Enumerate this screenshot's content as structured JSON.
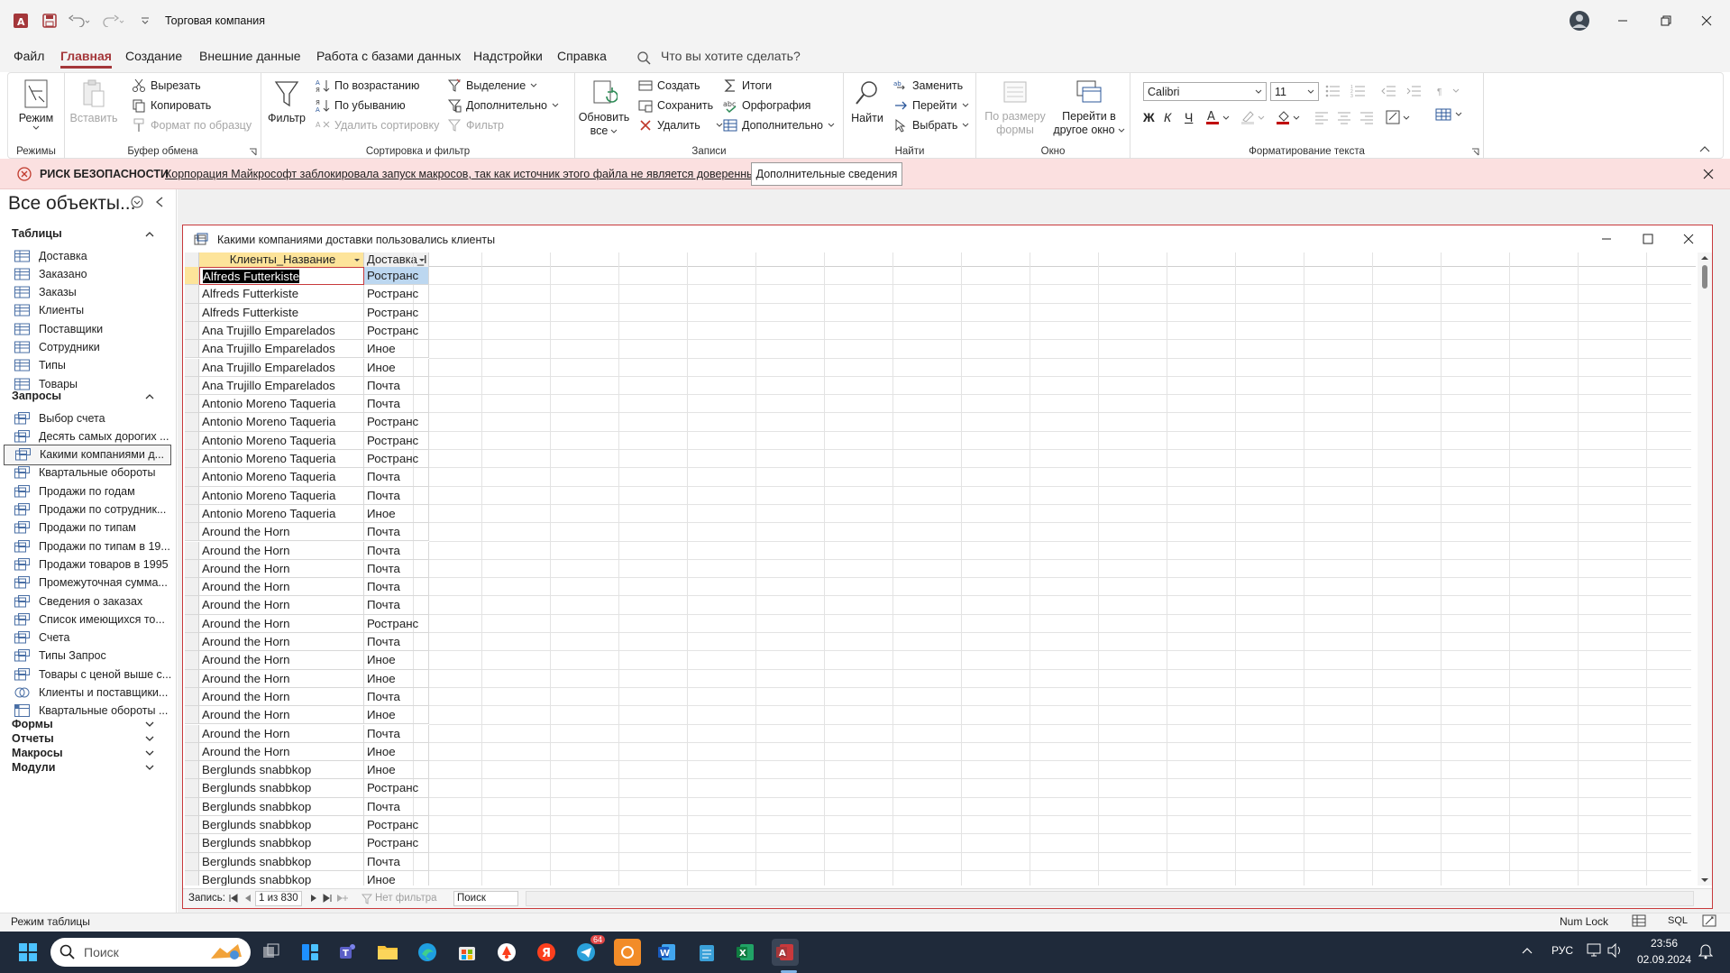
{
  "app": {
    "window_title": "Торговая компания",
    "brand_color": "#a4373a",
    "qat_icons": [
      "access-logo-icon",
      "save-icon",
      "undo-icon",
      "redo-icon",
      "customize-qat-icon"
    ],
    "window_controls": [
      "minimize-icon",
      "restore-icon",
      "close-icon"
    ]
  },
  "menu": {
    "tabs": [
      "Файл",
      "Главная",
      "Создание",
      "Внешние данные",
      "Работа с базами данных",
      "Надстройки",
      "Справка"
    ],
    "active_tab": "Главная",
    "search_placeholder": "Что вы хотите сделать?"
  },
  "ribbon": {
    "groups": {
      "views": {
        "title": "Режимы",
        "mode": "Режим"
      },
      "clipboard": {
        "title": "Буфер обмена",
        "paste": "Вставить",
        "cut": "Вырезать",
        "copy": "Копировать",
        "format_painter": "Формат по образцу"
      },
      "sort_filter": {
        "title": "Сортировка и фильтр",
        "filter": "Фильтр",
        "ascending": "По возрастанию",
        "descending": "По убыванию",
        "remove_sort": "Удалить сортировку",
        "selection": "Выделение",
        "advanced": "Дополнительно",
        "toggle_filter": "Фильтр"
      },
      "records": {
        "title": "Записи",
        "refresh_1": "Обновить",
        "refresh_2": "все",
        "new": "Создать",
        "save": "Сохранить",
        "delete": "Удалить",
        "totals": "Итоги",
        "spelling": "Орфография",
        "more": "Дополнительно"
      },
      "find": {
        "title": "Найти",
        "find": "Найти",
        "replace": "Заменить",
        "goto": "Перейти",
        "select": "Выбрать"
      },
      "window": {
        "title": "Окно",
        "fit_1": "По размеру",
        "fit_2": "формы",
        "switch_1": "Перейти в",
        "switch_2": "другое окно"
      },
      "text_format": {
        "title": "Форматирование текста",
        "font": "Calibri",
        "size": "11",
        "bold": "Ж",
        "italic": "К",
        "underline": "Ч"
      }
    }
  },
  "security_bar": {
    "label": "РИСК БЕЗОПАСНОСТИ",
    "message": "Корпорация Майкрософт заблокировала запуск макросов, так как источник этого файла не является доверенным.",
    "button": "Дополнительные сведения"
  },
  "nav_pane": {
    "header": "Все объекты...",
    "sections": [
      {
        "label": "Таблицы",
        "expanded": true,
        "items": [
          "Доставка",
          "Заказано",
          "Заказы",
          "Клиенты",
          "Поставщики",
          "Сотрудники",
          "Типы",
          "Товары"
        ]
      },
      {
        "label": "Запросы",
        "expanded": true,
        "items": [
          "Выбор счета",
          "Десять самых дорогих ...",
          "Какими компаниями д...",
          "Квартальные обороты",
          "Продажи по годам",
          "Продажи по сотрудник...",
          "Продажи по типам",
          "Продажи по типам в 19...",
          "Продажи товаров в 1995",
          "Промежуточная сумма...",
          "Сведения о заказах",
          "Список имеющихся то...",
          "Счета",
          "Типы Запрос",
          "Товары с ценой выше с...",
          "Клиенты и поставщики...",
          "Квартальные обороты ..."
        ]
      },
      {
        "label": "Формы",
        "expanded": false
      },
      {
        "label": "Отчеты",
        "expanded": false
      },
      {
        "label": "Макросы",
        "expanded": false
      },
      {
        "label": "Модули",
        "expanded": false
      }
    ],
    "selected_item": "Какими компаниями д..."
  },
  "query_window": {
    "title": "Какими компаниями доставки пользовались клиенты",
    "columns": [
      "Клиенты_Название",
      "Доставка_I"
    ],
    "rows": [
      [
        "Alfreds Futterkiste",
        "Ространс"
      ],
      [
        "Alfreds Futterkiste",
        "Ространс"
      ],
      [
        "Alfreds Futterkiste",
        "Ространс"
      ],
      [
        "Ana Trujillo Emparelados",
        "Ространс"
      ],
      [
        "Ana Trujillo Emparelados",
        "Иное"
      ],
      [
        "Ana Trujillo Emparelados",
        "Иное"
      ],
      [
        "Ana Trujillo Emparelados",
        "Почта"
      ],
      [
        "Antonio Moreno Taqueria",
        "Почта"
      ],
      [
        "Antonio Moreno Taqueria",
        "Ространс"
      ],
      [
        "Antonio Moreno Taqueria",
        "Ространс"
      ],
      [
        "Antonio Moreno Taqueria",
        "Ространс"
      ],
      [
        "Antonio Moreno Taqueria",
        "Почта"
      ],
      [
        "Antonio Moreno Taqueria",
        "Почта"
      ],
      [
        "Antonio Moreno Taqueria",
        "Иное"
      ],
      [
        "Around the Horn",
        "Почта"
      ],
      [
        "Around the Horn",
        "Почта"
      ],
      [
        "Around the Horn",
        "Почта"
      ],
      [
        "Around the Horn",
        "Почта"
      ],
      [
        "Around the Horn",
        "Почта"
      ],
      [
        "Around the Horn",
        "Ространс"
      ],
      [
        "Around the Horn",
        "Почта"
      ],
      [
        "Around the Horn",
        "Иное"
      ],
      [
        "Around the Horn",
        "Иное"
      ],
      [
        "Around the Horn",
        "Почта"
      ],
      [
        "Around the Horn",
        "Иное"
      ],
      [
        "Around the Horn",
        "Почта"
      ],
      [
        "Around the Horn",
        "Иное"
      ],
      [
        "Berglunds snabbkop",
        "Иное"
      ],
      [
        "Berglunds snabbkop",
        "Ространс"
      ],
      [
        "Berglunds snabbkop",
        "Почта"
      ],
      [
        "Berglunds snabbkop",
        "Ространс"
      ],
      [
        "Berglunds snabbkop",
        "Ространс"
      ],
      [
        "Berglunds snabbkop",
        "Почта"
      ],
      [
        "Berglunds snabbkop",
        "Иное"
      ]
    ],
    "record_nav": {
      "label": "Запись:",
      "position": "1 из 830",
      "filter": "Нет фильтра",
      "search": "Поиск"
    }
  },
  "statusbar": {
    "mode": "Режим таблицы",
    "numlock": "Num Lock",
    "sql": "SQL"
  },
  "taskbar": {
    "search_placeholder": "Поиск",
    "language": "РУС",
    "time": "23:56",
    "date": "02.09.2024",
    "telegram_badge": "64"
  }
}
